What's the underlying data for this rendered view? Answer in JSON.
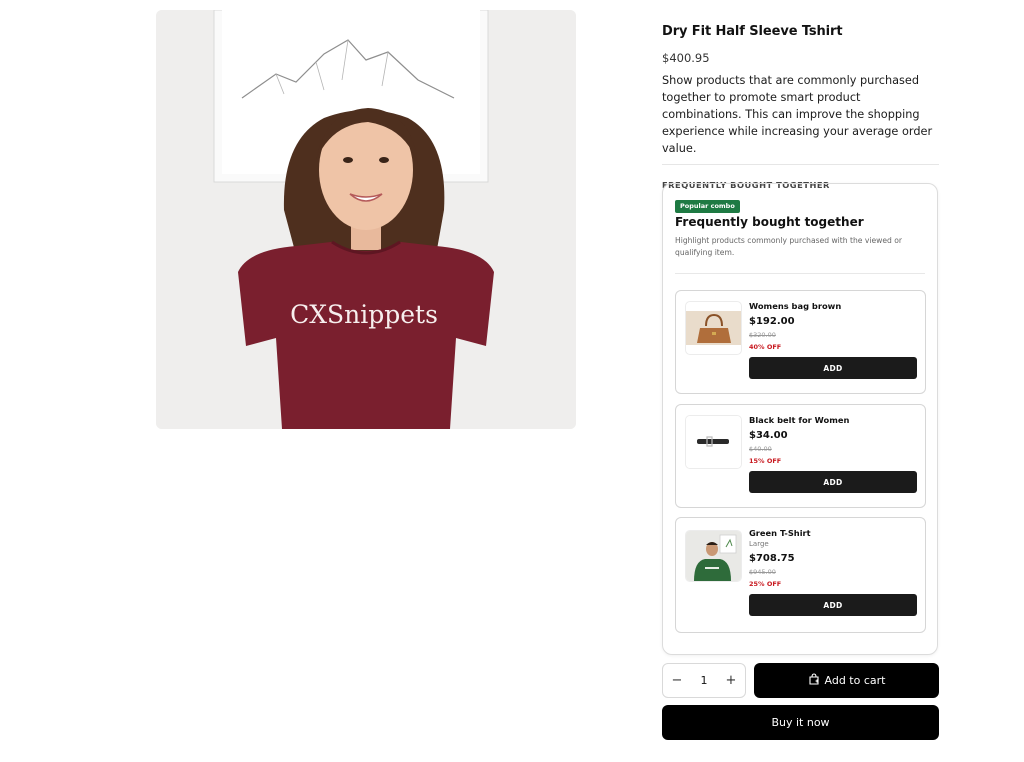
{
  "product": {
    "title": "Dry Fit Half Sleeve Tshirt",
    "price": "$400.95",
    "description": "Show products that are commonly purchased together to promote smart product combinations. This can improve the shopping experience while increasing your average order value.",
    "image_shirt_text": "CXSnippets",
    "image_colors": {
      "shirt": "#7a1f2e",
      "background": "#efeeed"
    }
  },
  "frequently_bought": {
    "section_heading": "FREQUENTLY BOUGHT TOGETHER",
    "badge": "Popular combo",
    "title": "Frequently bought together",
    "subtitle": "Highlight products commonly purchased with the viewed or qualifying item.",
    "items": [
      {
        "name": "Womens bag brown",
        "variant": "",
        "price": "$192.00",
        "compare_price": "$320.00",
        "discount": "40% OFF",
        "button_label": "ADD",
        "thumb": "brown-handbag"
      },
      {
        "name": "Black belt for Women",
        "variant": "",
        "price": "$34.00",
        "compare_price": "$40.00",
        "discount": "15% OFF",
        "button_label": "ADD",
        "thumb": "black-belt"
      },
      {
        "name": "Green T-Shirt",
        "variant": "Large",
        "price": "$708.75",
        "compare_price": "$945.00",
        "discount": "25% OFF",
        "button_label": "ADD",
        "thumb": "green-tshirt-model"
      }
    ]
  },
  "purchase": {
    "quantity": "1",
    "minus_label": "−",
    "plus_label": "+",
    "add_to_cart_label": "Add to cart",
    "buy_now_label": "Buy it now"
  },
  "colors": {
    "button": "#000000",
    "badge": "#1e7a43",
    "discount": "#c8191f"
  }
}
